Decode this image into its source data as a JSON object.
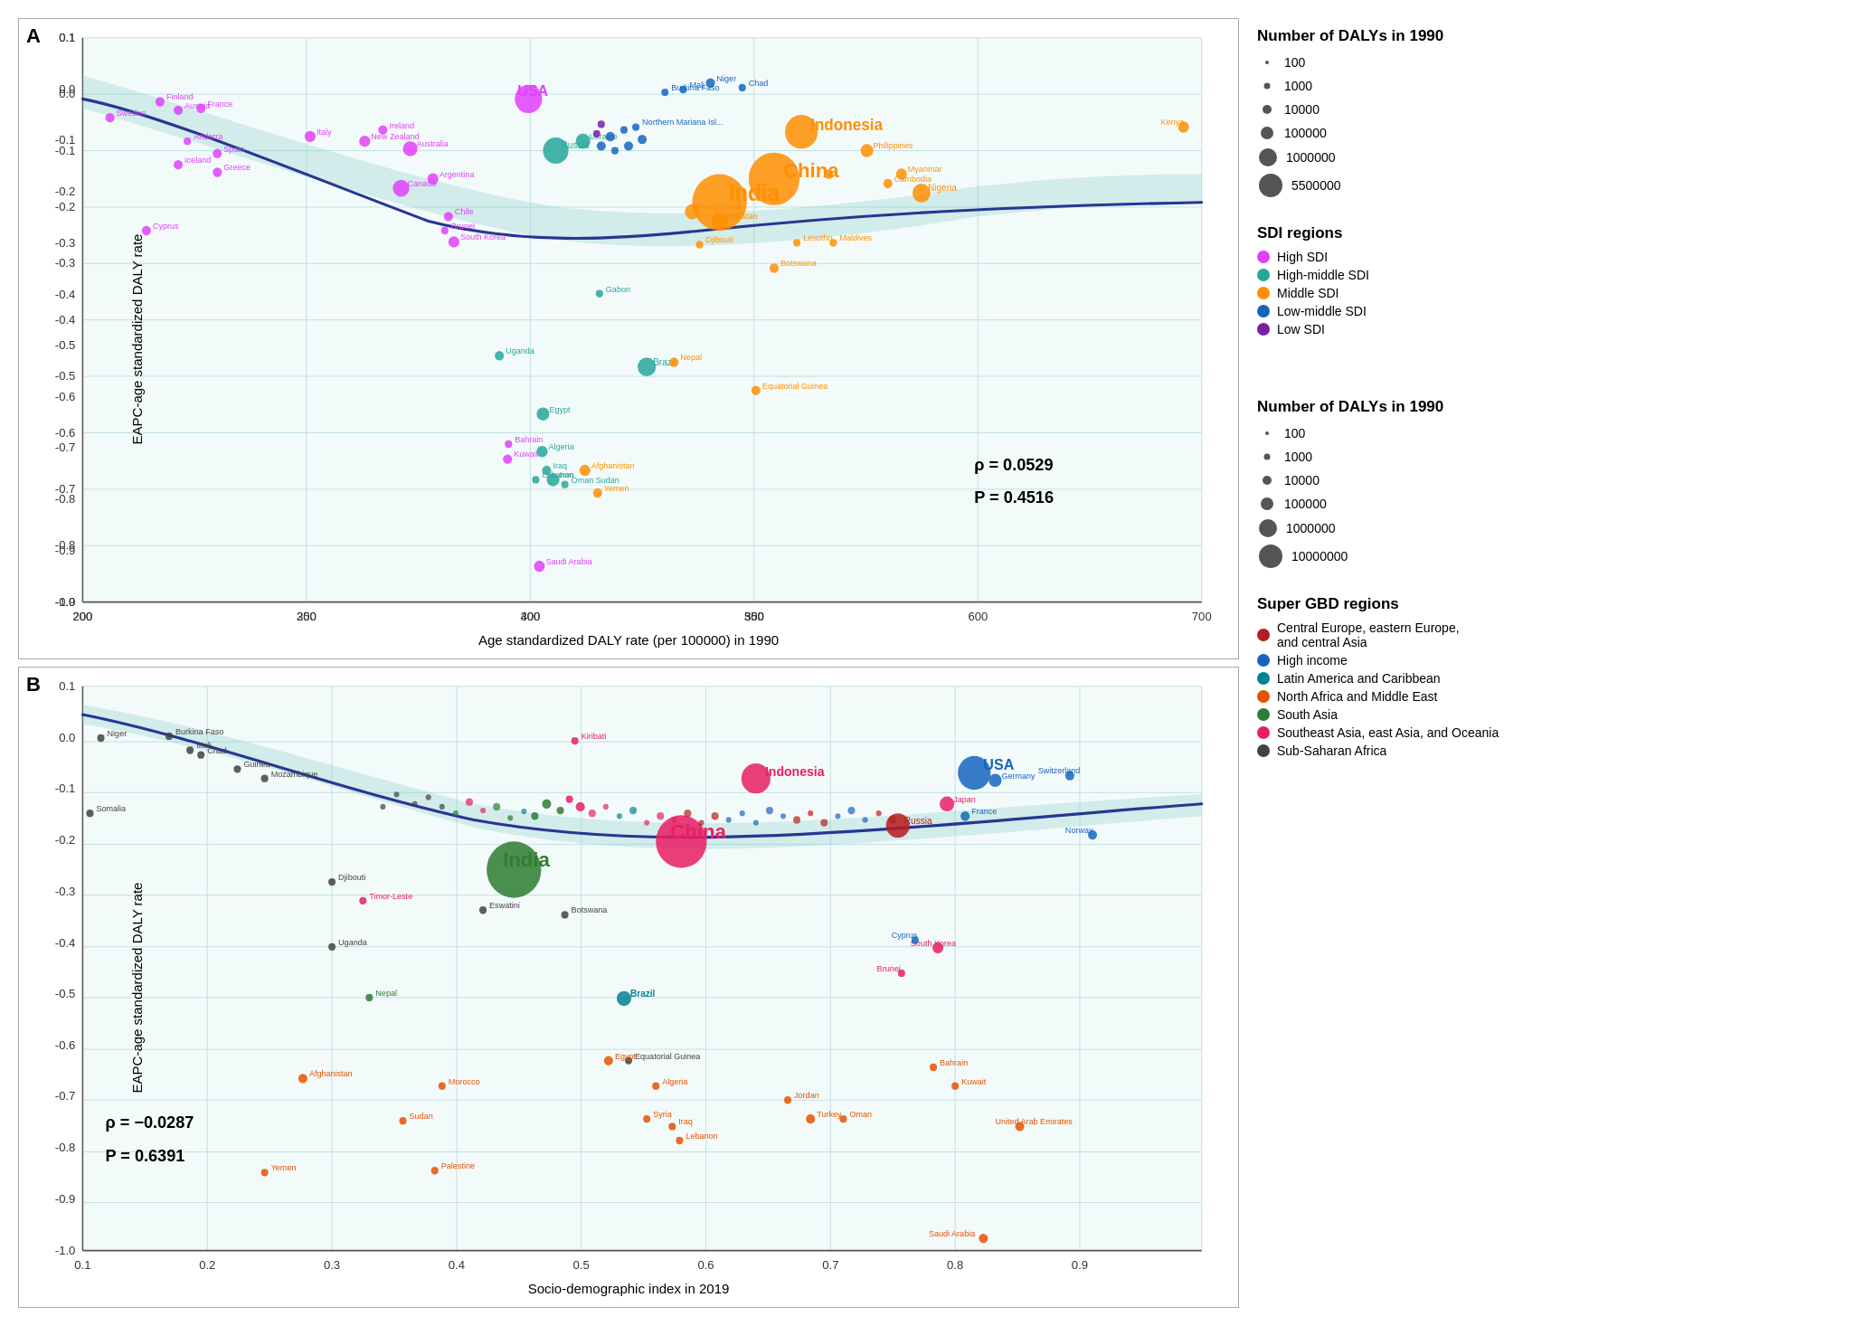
{
  "panels": [
    {
      "id": "A",
      "label": "A",
      "rho": "ρ = 0.0529",
      "p_value": "P = 0.4516",
      "x_axis": "Age standardized DALY rate (per 100000) in 1990",
      "y_axis": "EAPC-age standardized DALY rate",
      "x_min": 200,
      "x_max": 700,
      "y_min": -1.0,
      "y_max": 0.1
    },
    {
      "id": "B",
      "label": "B",
      "rho": "ρ = −0.0287",
      "p_value": "P = 0.6391",
      "x_axis": "Socio-demographic index in 2019",
      "y_axis": "EAPC-age standardized DALY rate",
      "x_min": 0.1,
      "x_max": 1.0,
      "y_min": -1.0,
      "y_max": 0.1
    }
  ],
  "legend_top": {
    "title": "Number of DALYs in 1990",
    "sizes": [
      {
        "label": "100",
        "size": 2
      },
      {
        "label": "1000",
        "size": 4
      },
      {
        "label": "10000",
        "size": 6
      },
      {
        "label": "100000",
        "size": 9
      },
      {
        "label": "1000000",
        "size": 13
      },
      {
        "label": "5500000",
        "size": 18
      }
    ],
    "sdi_title": "SDI regions",
    "sdi_items": [
      {
        "label": "High SDI",
        "color": "#e040fb"
      },
      {
        "label": "High-middle SDI",
        "color": "#26a69a"
      },
      {
        "label": "Middle SDI",
        "color": "#ff8f00"
      },
      {
        "label": "Low-middle SDI",
        "color": "#1565c0"
      },
      {
        "label": "Low SDI",
        "color": "#7b1fa2"
      }
    ]
  },
  "legend_bottom": {
    "title": "Number of DALYs in 1990",
    "sizes": [
      {
        "label": "100",
        "size": 2
      },
      {
        "label": "1000",
        "size": 4
      },
      {
        "label": "10000",
        "size": 6
      },
      {
        "label": "100000",
        "size": 9
      },
      {
        "label": "1000000",
        "size": 13
      },
      {
        "label": "10000000",
        "size": 18
      }
    ],
    "region_title": "Super GBD regions",
    "region_items": [
      {
        "label": "Central Europe, eastern Europe, and central Asia",
        "color": "#b71c1c"
      },
      {
        "label": "High income",
        "color": "#1565c0"
      },
      {
        "label": "Latin America and Caribbean",
        "color": "#00838f"
      },
      {
        "label": "North Africa and Middle East",
        "color": "#e65100"
      },
      {
        "label": "South Asia",
        "color": "#2e7d32"
      },
      {
        "label": "Southeast Asia, east Asia, and Oceania",
        "color": "#e91e63"
      },
      {
        "label": "Sub-Saharan Africa",
        "color": "#424242"
      }
    ]
  }
}
